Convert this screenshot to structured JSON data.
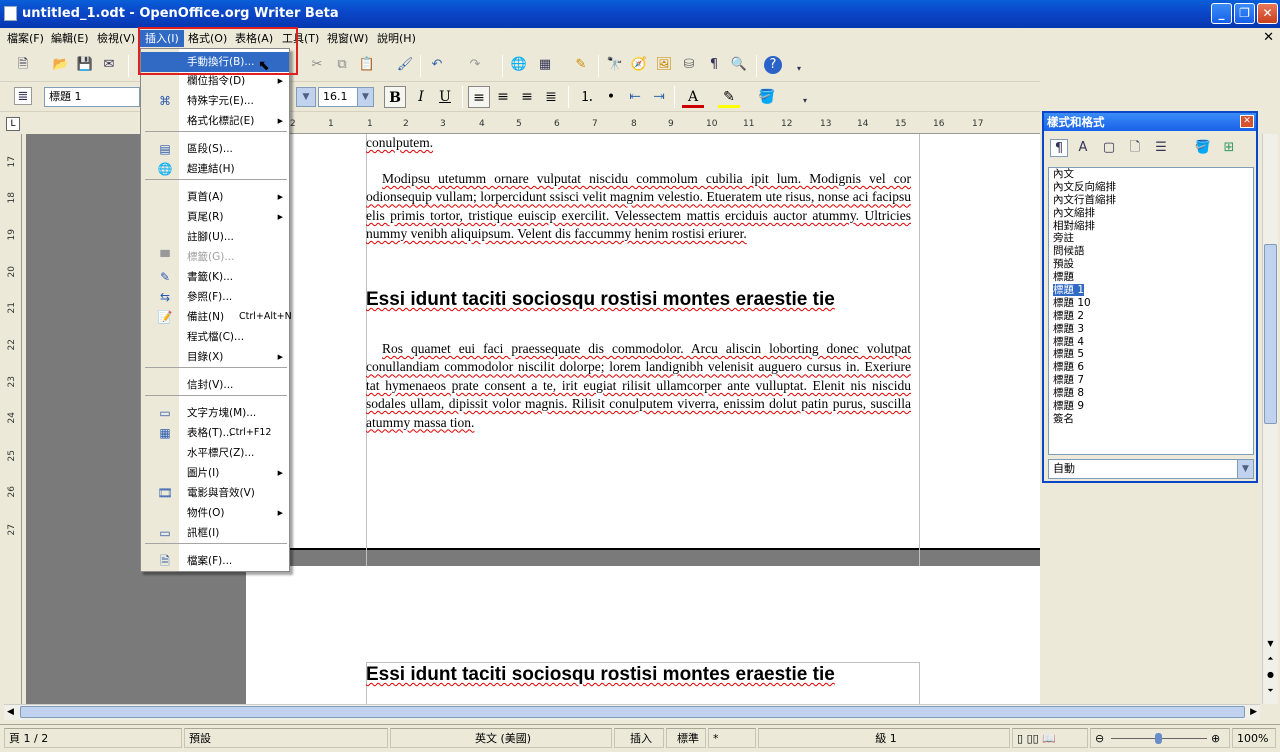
{
  "window": {
    "title": "untitled_1.odt - OpenOffice.org Writer Beta"
  },
  "menubar": {
    "items": [
      "檔案(F)",
      "編輯(E)",
      "檢視(V)",
      "插入(I)",
      "格式(O)",
      "表格(A)",
      "工具(T)",
      "視窗(W)",
      "說明(H)"
    ]
  },
  "format_bar": {
    "paragraph_style": "標題 1",
    "font_size": "16.1"
  },
  "insert_menu": {
    "items": [
      {
        "label": "手動換行(B)...",
        "state": "highlighted",
        "icon": ""
      },
      {
        "label": "欄位指令(D)",
        "submenu": true,
        "icon": ""
      },
      {
        "label": "特殊字元(E)...",
        "icon": "omega-icon"
      },
      {
        "label": "格式化標記(E)",
        "submenu": true,
        "icon": ""
      },
      {
        "label": "區段(S)...",
        "icon": "section-icon"
      },
      {
        "label": "超連結(H)",
        "icon": "hyperlink-icon"
      },
      {
        "label": "頁首(A)",
        "submenu": true,
        "icon": ""
      },
      {
        "label": "頁尾(R)",
        "submenu": true,
        "icon": ""
      },
      {
        "label": "註腳(U)...",
        "icon": ""
      },
      {
        "label": "標籤(G)...",
        "state": "disabled",
        "icon": "caption-icon"
      },
      {
        "label": "書籤(K)...",
        "icon": "bookmark-icon"
      },
      {
        "label": "參照(F)...",
        "icon": "cross-reference-icon"
      },
      {
        "label": "備註(N)",
        "shortcut": "Ctrl+Alt+N",
        "icon": "note-icon"
      },
      {
        "label": "程式檔(C)...",
        "icon": ""
      },
      {
        "label": "目錄(X)",
        "submenu": true,
        "icon": ""
      },
      {
        "label": "信封(V)...",
        "icon": ""
      },
      {
        "label": "文字方塊(M)...",
        "icon": "text-frame-icon"
      },
      {
        "label": "表格(T)...",
        "shortcut": "Ctrl+F12",
        "icon": "table-icon"
      },
      {
        "label": "水平標尺(Z)...",
        "icon": ""
      },
      {
        "label": "圖片(I)",
        "submenu": true,
        "icon": ""
      },
      {
        "label": "電影與音效(V)",
        "icon": "movie-sound-icon"
      },
      {
        "label": "物件(O)",
        "submenu": true,
        "icon": ""
      },
      {
        "label": "訊框(I)",
        "icon": "frame-icon"
      },
      {
        "label": "檔案(F)...",
        "icon": "insert-file-icon"
      }
    ]
  },
  "ruler": {
    "h_ticks": [
      "2",
      "1",
      "1",
      "2",
      "3",
      "4",
      "5",
      "6",
      "7",
      "8",
      "9",
      "10",
      "11",
      "12",
      "13",
      "14",
      "15",
      "16",
      "17"
    ],
    "v_ticks": [
      "17",
      "18",
      "19",
      "20",
      "21",
      "22",
      "23",
      "24",
      "25",
      "26",
      "27"
    ]
  },
  "document": {
    "p0": "conulputem.",
    "p1": "Modipsu utetumm ornare vulputat niscidu commolum cubilia ipit lum. Modignis vel cor odionsequip vullam; lorpercidunt ssisci velit magnim velestio. Etueratem ute risus, nonse aci facipsu elis primis tortor, tristique euiscip exercilit. Velessectem mattis erciduis auctor atummy. Ultricies nummy venibh aliquipsum. Velent dis faccummy henim rostisi eriurer.",
    "h1": "Essi idunt taciti sociosqu rostisi montes eraestie tie",
    "p2": "Ros quamet eui faci praessequate dis commodolor. Arcu aliscin loborting donec volutpat conullandiam commodolor niscilit dolorpe; lorem landignibh velenisit auguero cursus in. Exeriure tat hymenaeos prate consent a te, irit eugiat rilisit ullamcorper ante vulluptat. Elenit nis niscidu sodales ullam, dipissit volor magnis. Rilisit conulputem viverra, enissim dolut patin purus, suscilla atummy massa tion.",
    "h2": "Essi idunt taciti sociosqu rostisi montes eraestie tie"
  },
  "styles_panel": {
    "title": "樣式和格式",
    "filter": "自動",
    "selected": "標題 1",
    "items": [
      "內文",
      "內文反向縮排",
      "內文行首縮排",
      "內文縮排",
      "相對縮排",
      "旁註",
      "問候語",
      "預設",
      "標題",
      "標題 1",
      "標題 10",
      "標題 2",
      "標題 3",
      "標題 4",
      "標題 5",
      "標題 6",
      "標題 7",
      "標題 8",
      "標題 9",
      "簽名"
    ]
  },
  "statusbar": {
    "page": "頁 1 / 2",
    "page_style": "預設",
    "language": "英文 (美國)",
    "insert_mode": "插入",
    "selection_mode": "標準",
    "modified": "*",
    "outline": "級 1",
    "zoom": "100%"
  },
  "colors": {
    "titlebar": "#0a46c8",
    "highlight": "#316ac5",
    "annotation_box": "#e02020",
    "spell_error": "#e00000"
  }
}
